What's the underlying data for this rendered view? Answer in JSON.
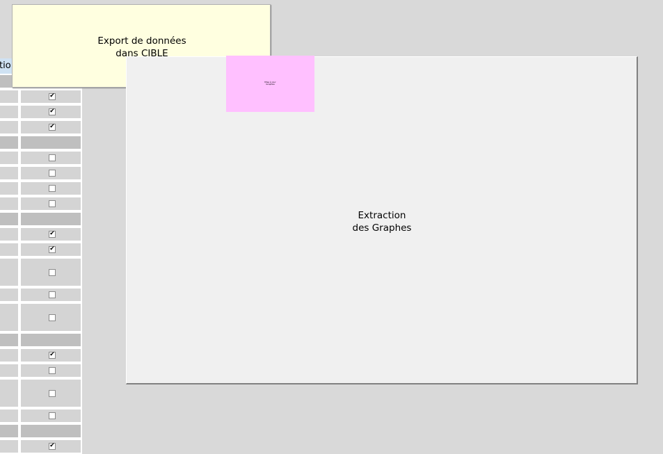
{
  "sheet": {
    "header_text": "tio",
    "rows": [
      {
        "type": "section"
      },
      {
        "type": "row",
        "checked": true
      },
      {
        "type": "row",
        "checked": true
      },
      {
        "type": "row",
        "checked": true
      },
      {
        "type": "section"
      },
      {
        "type": "row",
        "checked": false
      },
      {
        "type": "row",
        "checked": false
      },
      {
        "type": "row",
        "checked": false
      },
      {
        "type": "row",
        "checked": false
      },
      {
        "type": "section"
      },
      {
        "type": "row",
        "checked": true
      },
      {
        "type": "row",
        "checked": true
      },
      {
        "type": "row",
        "checked": false,
        "tall": true
      },
      {
        "type": "row",
        "checked": false
      },
      {
        "type": "row",
        "checked": false,
        "tall": true
      },
      {
        "type": "section"
      },
      {
        "type": "row",
        "checked": true
      },
      {
        "type": "row",
        "checked": false
      },
      {
        "type": "row",
        "checked": false,
        "tall": true
      },
      {
        "type": "row",
        "checked": false
      },
      {
        "type": "section"
      },
      {
        "type": "row",
        "checked": true
      }
    ]
  },
  "buttons": {
    "export_label": "Export de données\ndans CIBLE",
    "extraction_label": "Extraction\ndes Graphes",
    "small_label": "Mise à jour\nGraphes"
  }
}
